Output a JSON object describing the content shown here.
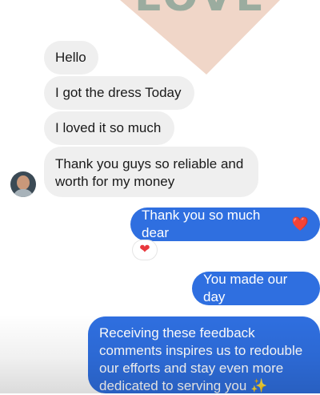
{
  "background_graphic": {
    "word": "LOVE",
    "heart_color": "#f0d6c8"
  },
  "messages": {
    "incoming": [
      {
        "text": "Hello"
      },
      {
        "text": "I got the dress Today"
      },
      {
        "text": "I loved it so much"
      },
      {
        "text": "Thank you guys so reliable and worth for my money"
      }
    ],
    "outgoing": [
      {
        "text": "Thank you so much dear",
        "emoji": "❤️"
      },
      {
        "text": "You made our day"
      },
      {
        "text": "Receiving these feedback comments inspires us to redouble our efforts and stay even more dedicated to serving you",
        "emoji": "✨"
      }
    ]
  },
  "reaction": {
    "emoji": "❤"
  },
  "colors": {
    "incoming_bubble": "#efefef",
    "outgoing_bubble": "#2f6fe0",
    "reaction_heart": "#e8383d"
  }
}
